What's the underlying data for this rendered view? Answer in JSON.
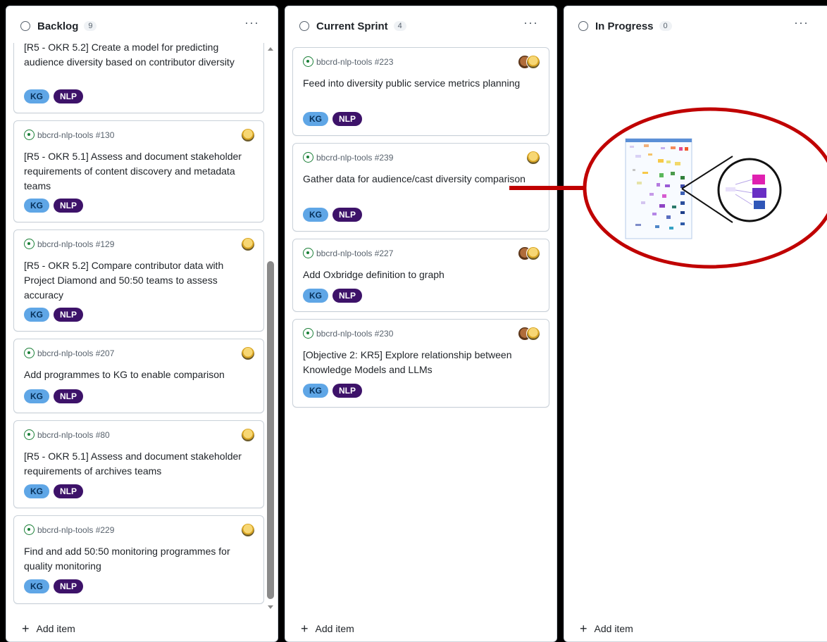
{
  "columns": {
    "backlog": {
      "title": "Backlog",
      "count": "9",
      "add_label": "Add item"
    },
    "sprint": {
      "title": "Current Sprint",
      "count": "4",
      "add_label": "Add item"
    },
    "progress": {
      "title": "In Progress",
      "count": "0",
      "add_label": "Add item"
    }
  },
  "more_label": "···",
  "add_plus": "+",
  "labels": {
    "kg": "KG",
    "nlp": "NLP"
  },
  "backlog_cards": [
    {
      "meta": "",
      "title": "[R5 - OKR 5.2] Create a model for predicting audience diversity based on contributor diversity"
    },
    {
      "meta": "bbcrd-nlp-tools #130",
      "title": "[R5 - OKR 5.1] Assess and document stakeholder requirements of content discovery and metadata teams"
    },
    {
      "meta": "bbcrd-nlp-tools #129",
      "title": "[R5 - OKR 5.2] Compare contributor data with Project Diamond and 50:50 teams to assess accuracy"
    },
    {
      "meta": "bbcrd-nlp-tools #207",
      "title": "Add programmes to KG to enable comparison"
    },
    {
      "meta": "bbcrd-nlp-tools #80",
      "title": "[R5 - OKR 5.1] Assess and document stakeholder requirements of archives teams"
    },
    {
      "meta": "bbcrd-nlp-tools #229",
      "title": "Find and add 50:50 monitoring programmes for quality monitoring"
    }
  ],
  "sprint_cards": [
    {
      "meta": "bbcrd-nlp-tools #223",
      "title": "Feed into diversity public service metrics planning"
    },
    {
      "meta": "bbcrd-nlp-tools #239",
      "title": "Gather data for audience/cast diversity comparison"
    },
    {
      "meta": "bbcrd-nlp-tools #227",
      "title": "Add Oxbridge definition to graph"
    },
    {
      "meta": "bbcrd-nlp-tools #230",
      "title": "[Objective 2: KR5] Explore relationship between Knowledge Models and LLMs"
    }
  ],
  "colors": {
    "callout_red": "#c00000",
    "kg": "#5fa6e6",
    "nlp": "#3d1269",
    "issue_open": "#1a7f37"
  }
}
